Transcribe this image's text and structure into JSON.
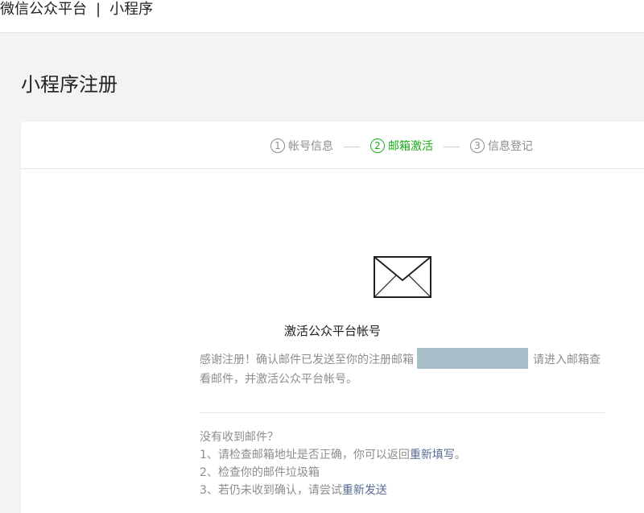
{
  "header": {
    "brand": "微信公众平台",
    "separator": "|",
    "product": "小程序"
  },
  "page": {
    "title": "小程序注册"
  },
  "steps": [
    {
      "num": "1",
      "label": "帐号信息",
      "state": "done"
    },
    {
      "num": "2",
      "label": "邮箱激活",
      "state": "active"
    },
    {
      "num": "3",
      "label": "信息登记",
      "state": "pending"
    }
  ],
  "activation": {
    "icon": "envelope-icon",
    "title": "激活公众平台帐号",
    "desc_before": "感谢注册！确认邮件已发送至你的注册邮箱",
    "desc_after": "请进入邮箱查看邮件，并激活公众平台帐号。"
  },
  "help": {
    "heading": "没有收到邮件？",
    "item1_text": "1、请检查邮箱地址是否正确，你可以返回",
    "item1_link": "重新填写",
    "item1_end": "。",
    "item2_text": "2、检查你的邮件垃圾箱",
    "item3_text": "3、若仍未收到确认，请尝试",
    "item3_link": "重新发送"
  },
  "colors": {
    "accent": "#1aad19",
    "link": "#576b95",
    "muted": "#8d8d8d",
    "email_mask": "#a9bfc9"
  }
}
